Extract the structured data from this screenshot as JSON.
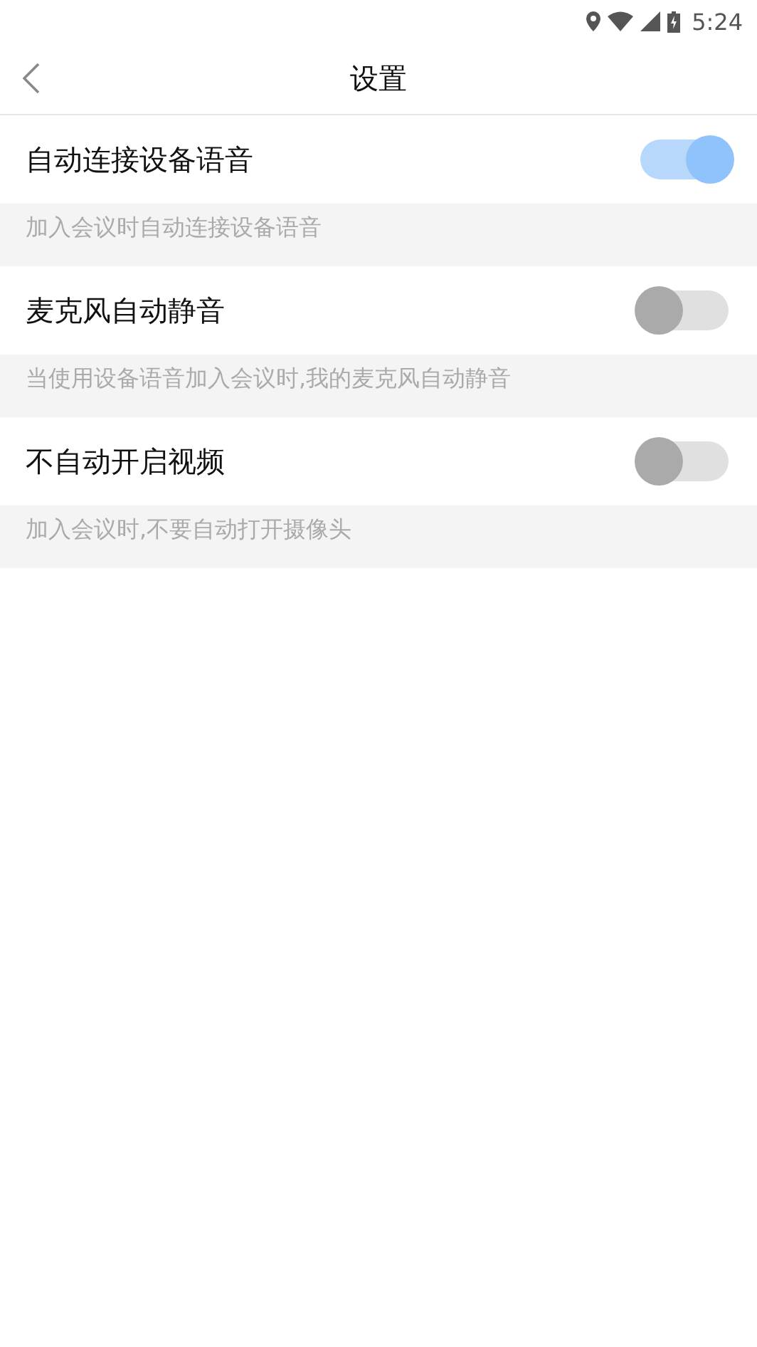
{
  "status_bar": {
    "time": "5:24"
  },
  "header": {
    "title": "设置"
  },
  "settings": [
    {
      "label": "自动连接设备语音",
      "on": true,
      "description": "加入会议时自动连接设备语音"
    },
    {
      "label": "麦克风自动静音",
      "on": false,
      "description": "当使用设备语音加入会议时,我的麦克风自动静音"
    },
    {
      "label": "不自动开启视频",
      "on": false,
      "description": "加入会议时,不要自动打开摄像头"
    }
  ]
}
